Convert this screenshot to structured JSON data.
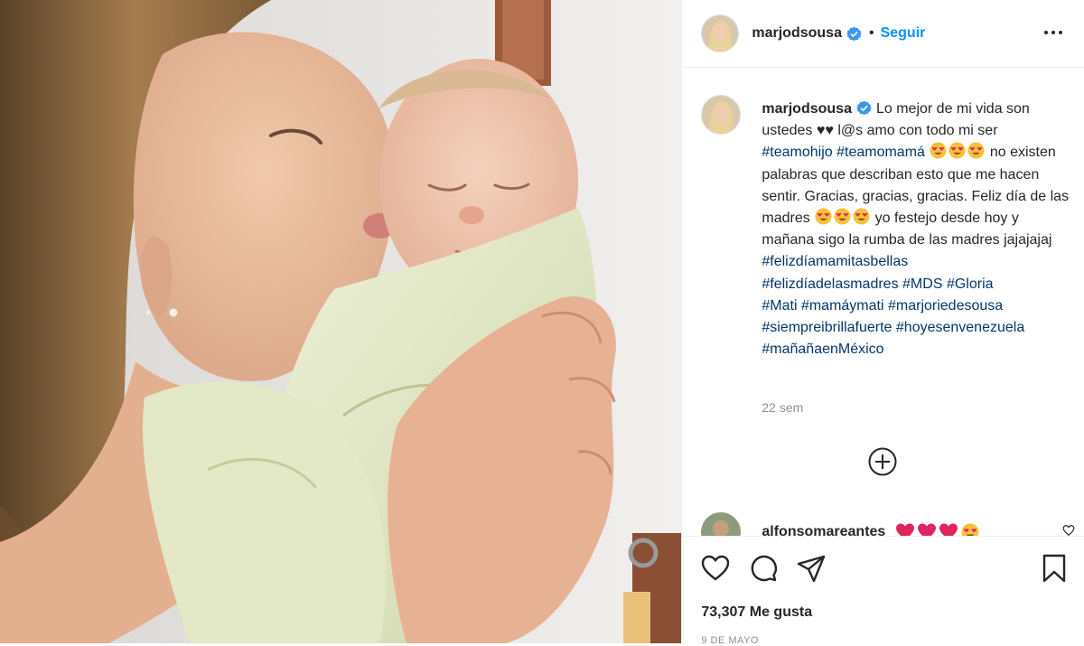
{
  "post": {
    "username": "marjodsousa",
    "verified": true,
    "follow_label": "Seguir",
    "separator": "•",
    "caption": {
      "text_1": "Lo mejor de mi vida son ustedes",
      "text_2": "♥♥",
      "text_3": "l@s amo con todo mi ser",
      "tag_teamohijo": "#teamohijo",
      "tag_teamomama": "#teamomamá",
      "text_4": "no existen palabras que describan esto que me hacen sentir. Gracias, gracias, gracias. Feliz día de las madres",
      "text_5": "yo festejo desde hoy y mañana sigo la rumba de las madres jajajajaj",
      "hashtags": [
        "#felizdíamamitasbellas",
        "#felizdíadelasmadres",
        "#MDS",
        "#Gloria",
        "#Mati",
        "#mamáymati",
        "#marjoriedesousa",
        "#siempreibrillafuerte",
        "#hoyesenvenezuela",
        "#mañañaenMéxico"
      ]
    },
    "time_ago": "22 sem",
    "comment": {
      "username": "alfonsomareantes",
      "emojis": [
        "red-heart",
        "red-heart",
        "red-heart",
        "heart-eyes"
      ]
    },
    "likes": "73,307 Me gusta",
    "date": "9 DE MAYO"
  },
  "icons": {
    "more": "more-options-icon",
    "verified": "verified-badge-icon",
    "load_more": "load-more-comments-icon",
    "like": "heart-icon",
    "comment": "comment-icon",
    "share": "share-icon",
    "save": "bookmark-icon"
  },
  "colors": {
    "link_blue": "#0095f6",
    "hashtag_blue": "#00376b",
    "muted": "#8e8e8e",
    "text": "#262626"
  }
}
